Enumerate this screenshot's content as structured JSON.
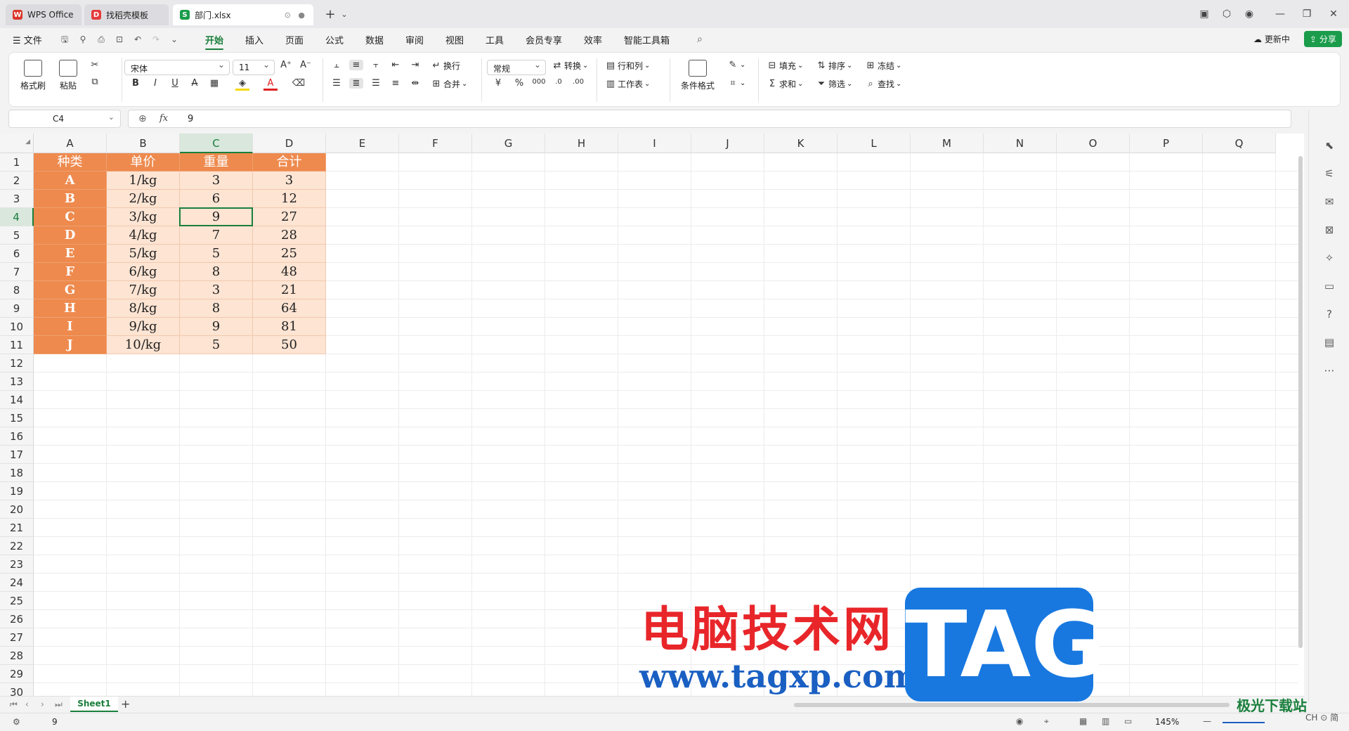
{
  "tabs": [
    {
      "label": "WPS Office",
      "color": "#d9362b",
      "glyph": "W"
    },
    {
      "label": "找稻壳模板",
      "color": "#e53b3b",
      "glyph": "D"
    },
    {
      "label": "部门.xlsx",
      "color": "#1a9c4a",
      "glyph": "S"
    }
  ],
  "menus": [
    "文件",
    "开始",
    "插入",
    "页面",
    "公式",
    "数据",
    "审阅",
    "视图",
    "工具",
    "会员专享",
    "效率",
    "智能工具箱"
  ],
  "menu_active": "开始",
  "titlebar_right": {
    "update": "更新中",
    "share": "分享"
  },
  "ribbon": {
    "format_painter": "格式刷",
    "paste": "粘贴",
    "font_name": "宋体",
    "font_size": "11",
    "wrap": "换行",
    "merge": "合并",
    "number_format": "常规",
    "convert": "转换",
    "rows_cols": "行和列",
    "worksheet": "工作表",
    "cond_format": "条件格式",
    "fill": "填充",
    "sort": "排序",
    "freeze": "冻结",
    "sum": "求和",
    "filter": "筛选",
    "find": "查找"
  },
  "formula_bar": {
    "name_box": "C4",
    "fx": "fx",
    "value": "9"
  },
  "columns": [
    "A",
    "B",
    "C",
    "D",
    "E",
    "F",
    "G",
    "H",
    "I",
    "J",
    "K",
    "L",
    "M",
    "N",
    "O",
    "P",
    "Q"
  ],
  "row_numbers": [
    "1",
    "2",
    "3",
    "4",
    "5",
    "6",
    "7",
    "8",
    "9",
    "10",
    "11",
    "12",
    "13",
    "14",
    "15",
    "16",
    "17",
    "18",
    "19",
    "20",
    "21",
    "22",
    "23",
    "24",
    "25",
    "26",
    "27",
    "28",
    "29",
    "30"
  ],
  "selected": {
    "col": "C",
    "row": "4"
  },
  "table": {
    "headers": [
      "种类",
      "单价",
      "重量",
      "合计"
    ],
    "rows": [
      [
        "A",
        "1/kg",
        "3",
        "3"
      ],
      [
        "B",
        "2/kg",
        "6",
        "12"
      ],
      [
        "C",
        "3/kg",
        "9",
        "27"
      ],
      [
        "D",
        "4/kg",
        "7",
        "28"
      ],
      [
        "E",
        "5/kg",
        "5",
        "25"
      ],
      [
        "F",
        "6/kg",
        "8",
        "48"
      ],
      [
        "G",
        "7/kg",
        "3",
        "21"
      ],
      [
        "H",
        "8/kg",
        "8",
        "64"
      ],
      [
        "I",
        "9/kg",
        "9",
        "81"
      ],
      [
        "J",
        "10/kg",
        "5",
        "50"
      ]
    ]
  },
  "sheet_tab": "Sheet1",
  "status": {
    "value": "9",
    "zoom": "145%",
    "ime": "CH ⊙ 简"
  },
  "watermark": {
    "cn": "电脑技术网",
    "url": "www.tagxp.com",
    "tag": "TAG",
    "logo": "极光下载站"
  },
  "colors": {
    "accent": "#1a7f3c",
    "header_fill": "#ee8a4e",
    "body_fill": "#fde4d3"
  }
}
